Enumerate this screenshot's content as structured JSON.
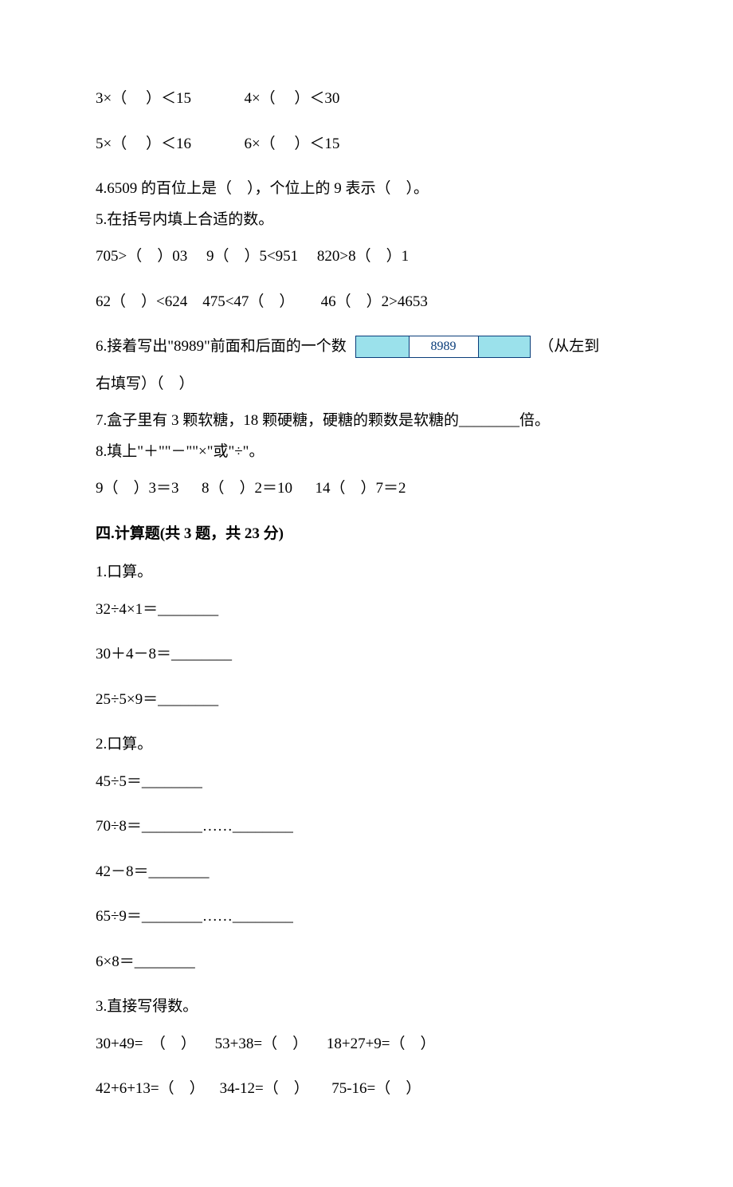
{
  "lines": {
    "r1": "3×（     ）＜15              4×（     ）＜30",
    "r2": "5×（     ）＜16              6×（     ）＜15",
    "q4": "4.6509 的百位上是（    ），个位上的 9 表示（    ）。",
    "q5": "5.在括号内填上合适的数。",
    "q5r1": "705>（    ）03     9（    ）5<951     820>8（    ）1",
    "q5r2": "62（    ）<624    475<47（    ）       46（    ）2>4653",
    "q6a": "6.接着写出\"8989\"前面和后面的一个数 ",
    "q6b": " （从左到",
    "q6c": "右填写）（    ）",
    "q7": "7.盒子里有 3 颗软糖，18 颗硬糖，硬糖的颗数是软糖的________倍。",
    "q8": "8.填上\"＋\"\"－\"\"×\"或\"÷\"。",
    "q8r": "9（    ）3＝3      8（    ）2＝10      14（    ）7＝2",
    "sec4": "四.计算题(共 3 题，共 23 分)",
    "c1": "1.口算。",
    "c1a": "32÷4×1＝________",
    "c1b": "30＋4－8＝________",
    "c1c": "25÷5×9＝________",
    "c2": "2.口算。",
    "c2a": "45÷5＝________",
    "c2b": "70÷8＝________……________",
    "c2c": "42－8＝________",
    "c2d": "65÷9＝________……________",
    "c2e": "6×8＝________",
    "c3": "3.直接写得数。",
    "c3r1": "30+49=  （    ）     53+38=（    ）     18+27+9=（    ）",
    "c3r2": "42+6+13=（    ）    34-12=（    ）      75-16=（    ）"
  },
  "box8989": "8989"
}
